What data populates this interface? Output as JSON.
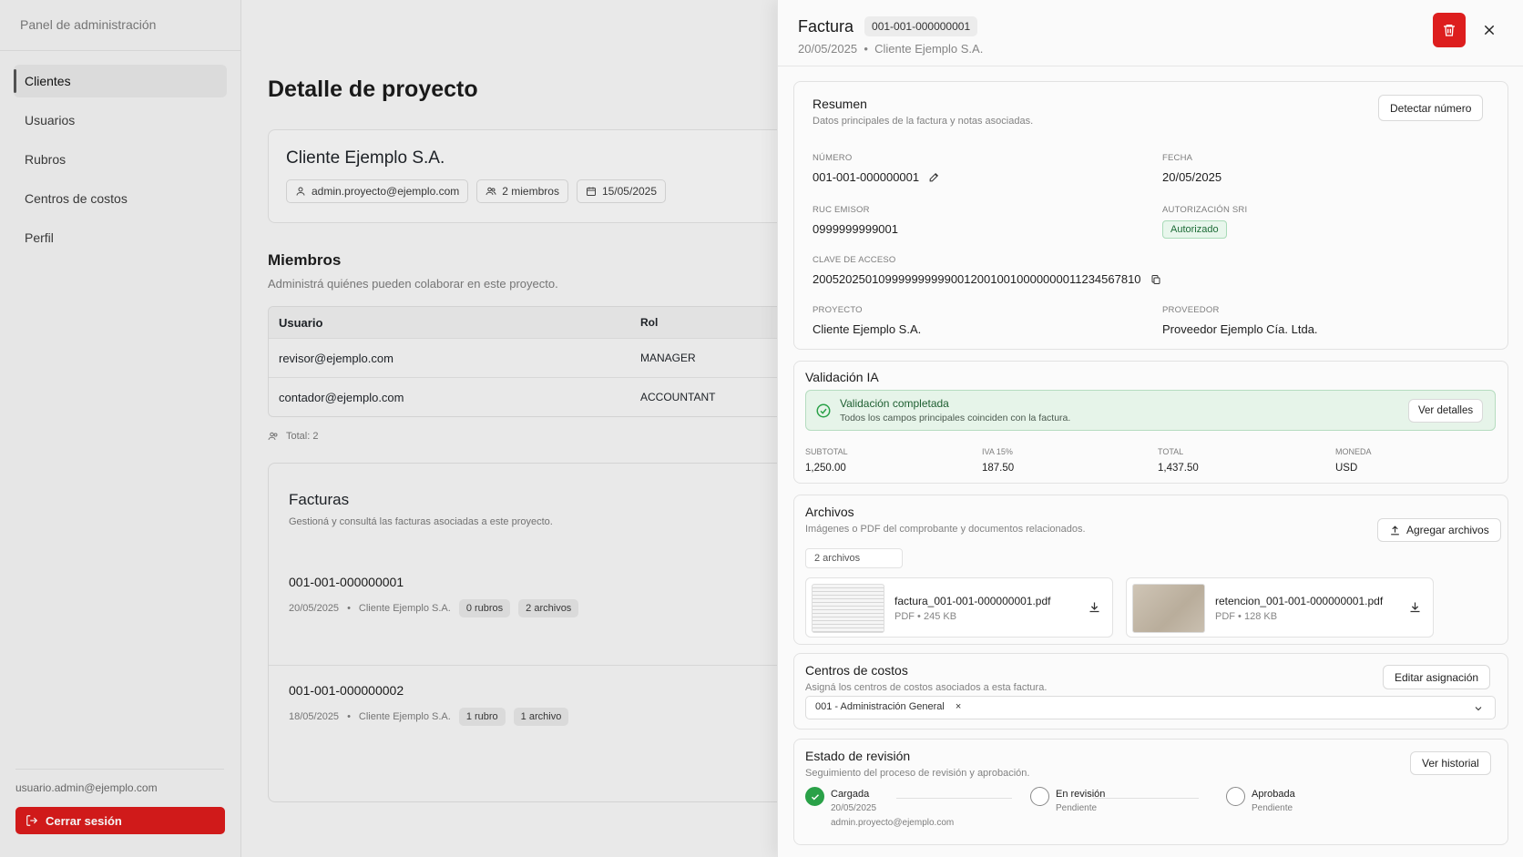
{
  "sidebar": {
    "brand": "Panel de administración",
    "items": [
      {
        "label": "Clientes"
      },
      {
        "label": "Usuarios"
      },
      {
        "label": "Rubros"
      },
      {
        "label": "Centros de costos"
      },
      {
        "label": "Perfil"
      }
    ],
    "user_email": "usuario.admin@ejemplo.com",
    "logout_label": "Cerrar sesión"
  },
  "main": {
    "page_title": "Detalle de proyecto",
    "project": {
      "name": "Cliente Ejemplo S.A.",
      "email": "admin.proyecto@ejemplo.com",
      "members_count": "2 miembros",
      "date": "15/05/2025"
    },
    "members": {
      "title": "Miembros",
      "subtitle": "Administrá quiénes pueden colaborar en este proyecto.",
      "headers": {
        "user": "Usuario",
        "role": "Rol"
      },
      "rows": [
        {
          "user": "revisor@ejemplo.com",
          "role": "MANAGER"
        },
        {
          "user": "contador@ejemplo.com",
          "role": "ACCOUNTANT"
        }
      ],
      "total": "Total: 2"
    },
    "invoices": {
      "title": "Facturas",
      "subtitle": "Gestioná y consultá las facturas asociadas a este proyecto.",
      "items": [
        {
          "number": "001-001-000000001",
          "date": "20/05/2025",
          "client": "Cliente Ejemplo S.A.",
          "rubros": "0 rubros",
          "files": "2 archivos"
        },
        {
          "number": "001-001-000000002",
          "date": "18/05/2025",
          "client": "Cliente Ejemplo S.A.",
          "rubros": "1 rubro",
          "files": "1 archivo"
        }
      ],
      "separator": "•"
    }
  },
  "panel": {
    "title": "Factura",
    "number_badge": "001-001-000000001",
    "meta_date": "20/05/2025",
    "meta_sep": "•",
    "meta_client": "Cliente Ejemplo S.A.",
    "accent_red": "#dd1e1e",
    "summary": {
      "title": "Resumen",
      "subtitle": "Datos principales de la factura y notas asociadas.",
      "detect_button": "Detectar número",
      "numero_label": "Número",
      "numero_value": "001-001-000000001",
      "fecha_label": "Fecha",
      "fecha_value": "20/05/2025",
      "ruc_label": "RUC emisor",
      "ruc_value": "0999999999001",
      "auth_label": "Autorización SRI",
      "auth_value": "Autorizado",
      "clave_label": "Clave de acceso",
      "clave_value": "2005202501099999999990012001001000000001123456781​0",
      "proyecto_label": "Proyecto",
      "proyecto_value": "Cliente Ejemplo S.A.",
      "proveedor_label": "Proveedor",
      "proveedor_value": "Proveedor Ejemplo Cía. Ltda."
    },
    "validation": {
      "title": "Validación IA",
      "status_title": "Validación completada",
      "status_sub": "Todos los campos principales coinciden con la factura.",
      "details_button": "Ver detalles",
      "subtotal_label": "Subtotal",
      "subtotal_value": "1,250.00",
      "iva_label": "IVA 15%",
      "iva_value": "187.50",
      "total_label": "Total",
      "total_value": "1,437.50",
      "moneda_label": "Moneda",
      "moneda_value": "USD",
      "accent_green": "#2aa148"
    },
    "files": {
      "title": "Archivos",
      "subtitle": "Imágenes o PDF del comprobante y documentos relacionados.",
      "add_button": "Agregar archivos",
      "count": "2 archivos",
      "items": [
        {
          "name": "factura_001-001-000000001.pdf",
          "meta": "PDF • 245 KB"
        },
        {
          "name": "retencion_001-001-000000001.pdf",
          "meta": "PDF • 128 KB"
        }
      ]
    },
    "cost_centers": {
      "title": "Centros de costos",
      "subtitle": "Asigná los centros de costos asociados a esta factura.",
      "edit_button": "Editar asignación",
      "selected": "001 - Administración General",
      "remove_glyph": "×"
    },
    "review": {
      "title": "Estado de revisión",
      "subtitle": "Seguimiento del proceso de revisión y aprobación.",
      "history_button": "Ver historial",
      "steps": [
        {
          "name": "Cargada",
          "sub": "20/05/2025",
          "sub2": "admin.proyecto@ejemplo.com"
        },
        {
          "name": "En revisión",
          "sub": "Pendiente"
        },
        {
          "name": "Aprobada",
          "sub": "Pendiente"
        }
      ]
    }
  }
}
